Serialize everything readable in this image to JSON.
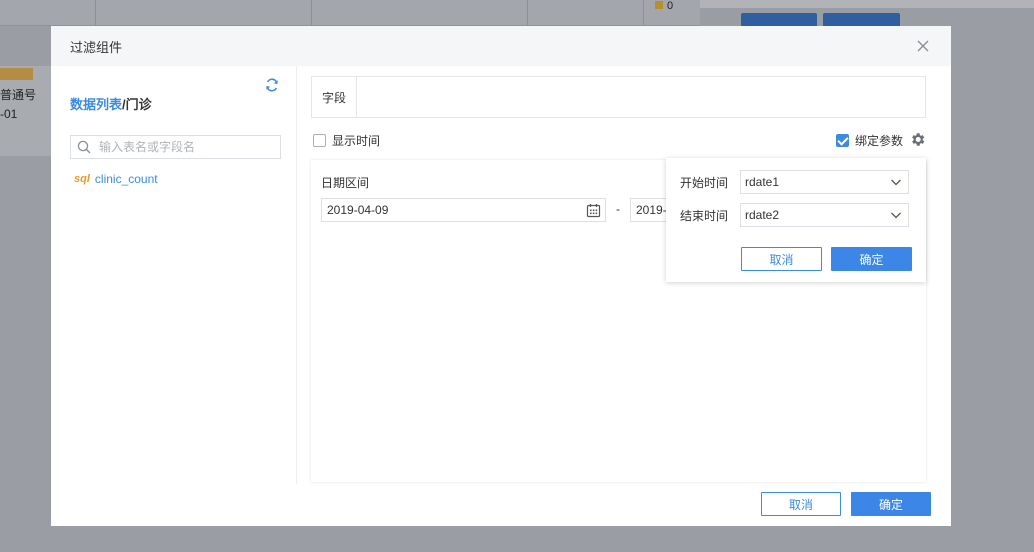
{
  "background": {
    "zero_value": "0",
    "left_text_1": "普通号",
    "left_text_2": "-01"
  },
  "modal": {
    "title": "过滤组件"
  },
  "left_pane": {
    "dataset_link": "数据列表",
    "dataset_rest": "/门诊",
    "search_placeholder": "输入表名或字段名",
    "table_badge": "sql",
    "table_name": "clinic_count"
  },
  "right_pane": {
    "field_label": "字段",
    "show_time_label": "显示时间",
    "show_time_checked": false,
    "bind_param_label": "绑定参数",
    "bind_param_checked": true,
    "range_label": "日期区间",
    "start_date": "2019-04-09",
    "dash": "-",
    "end_date": "2019-"
  },
  "popover": {
    "start_label": "开始时间",
    "start_value": "rdate1",
    "end_label": "结束时间",
    "end_value": "rdate2",
    "cancel_label": "取消",
    "ok_label": "确定"
  },
  "footer": {
    "cancel_label": "取消",
    "ok_label": "确定"
  },
  "colors": {
    "accent": "#3c8be0",
    "primary_button": "#3b86e6",
    "sql_badge": "#e89a2c"
  }
}
